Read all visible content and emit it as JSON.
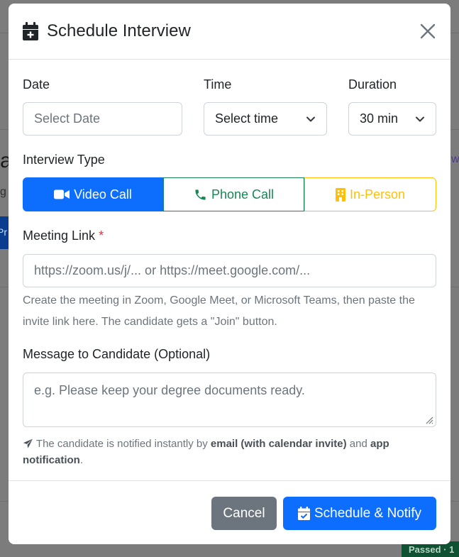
{
  "background": {
    "frag_a": "a",
    "frag_g": "g",
    "frag_pr": "Pr",
    "frag_w": "w",
    "badge": "Passed · 1"
  },
  "modal": {
    "title": "Schedule Interview",
    "date": {
      "label": "Date",
      "placeholder": "Select Date"
    },
    "time": {
      "label": "Time",
      "value": "Select time"
    },
    "duration": {
      "label": "Duration",
      "value": "30 min"
    },
    "interview_type": {
      "label": "Interview Type",
      "options": [
        "Video Call",
        "Phone Call",
        "In-Person"
      ],
      "selected": "Video Call"
    },
    "meeting_link": {
      "label": "Meeting Link",
      "required_mark": "*",
      "placeholder": "https://zoom.us/j/... or https://meet.google.com/...",
      "help": "Create the meeting in Zoom, Google Meet, or Microsoft Teams, then paste the invite link here. The candidate gets a \"Join\" button."
    },
    "message": {
      "label": "Message to Candidate (Optional)",
      "placeholder": "e.g. Please keep your degree documents ready."
    },
    "notice": {
      "prefix": "The candidate is notified instantly by ",
      "bold1": "email (with calendar invite)",
      "middle": " and ",
      "bold2": "app notification",
      "suffix": "."
    },
    "footer": {
      "cancel_label": "Cancel",
      "submit_label": "Schedule & Notify"
    }
  },
  "colors": {
    "primary": "#0d6efd",
    "success": "#198754",
    "warning": "#ffc107",
    "secondary": "#6c757d",
    "danger": "#dc3545"
  },
  "icons": [
    "calendar-plus-icon",
    "close-icon",
    "chevron-down-icon",
    "video-icon",
    "phone-icon",
    "building-icon",
    "paper-plane-icon",
    "calendar-check-icon"
  ]
}
